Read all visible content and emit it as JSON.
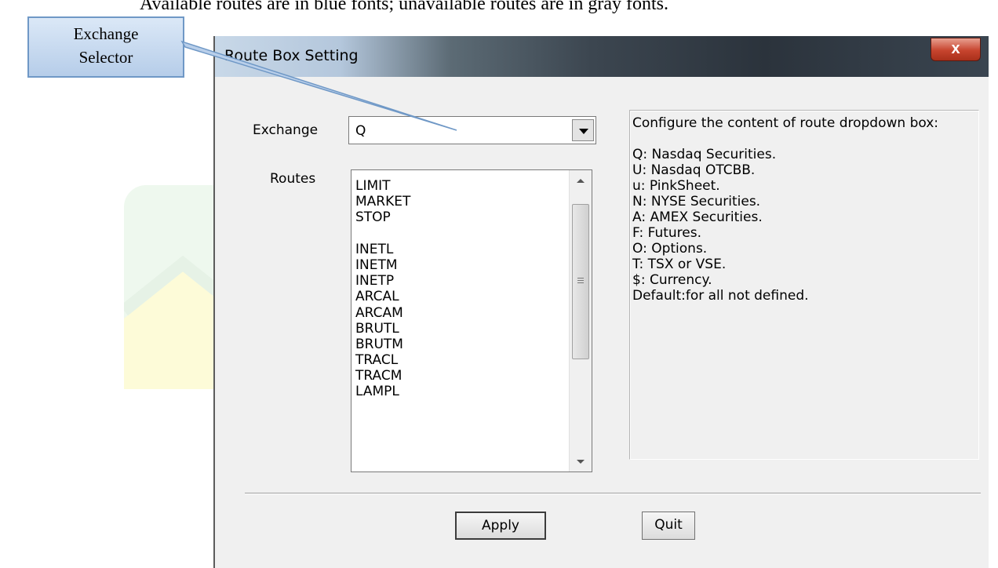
{
  "caption": "Available routes are in blue fonts; unavailable routes are in gray fonts.",
  "callout": {
    "line1": "Exchange",
    "line2": "Selector"
  },
  "dialog": {
    "title": "Route Box Setting",
    "close_label": "x",
    "exchange_label": "Exchange",
    "exchange_value": "Q",
    "routes_label": "Routes",
    "routes": [
      "LIMIT",
      "MARKET",
      "STOP",
      "",
      "INETL",
      "INETM",
      "INETP",
      "ARCAL",
      "ARCAM",
      "BRUTL",
      "BRUTM",
      "TRACL",
      "TRACM",
      "LAMPL"
    ],
    "description": [
      "Configure the content of route dropdown box:",
      "",
      "Q: Nasdaq Securities.",
      "U: Nasdaq OTCBB.",
      "u: PinkSheet.",
      "N: NYSE Securities.",
      "A: AMEX Securities.",
      "F: Futures.",
      "O: Options.",
      "T: TSX or VSE.",
      "$: Currency.",
      "Default:for all not defined."
    ],
    "apply_label": "Apply",
    "quit_label": "Quit"
  }
}
